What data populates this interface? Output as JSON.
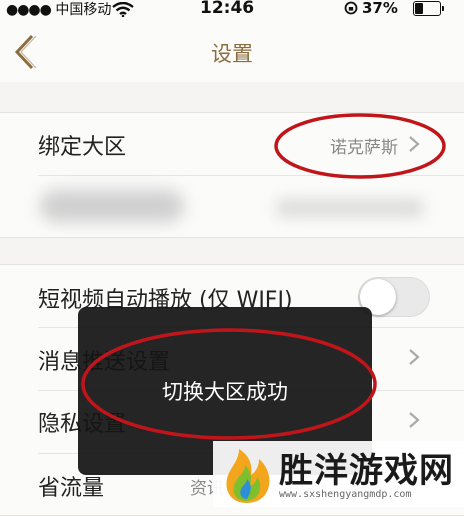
{
  "status_bar": {
    "carrier": "中国移动",
    "time": "12:46",
    "battery_percent": "37%",
    "battery_level": 0.37
  },
  "nav": {
    "back_icon": "chevron-left-icon",
    "title": "设置"
  },
  "settings": {
    "region": {
      "label": "绑定大区",
      "value": "诺克萨斯"
    },
    "autoplay": {
      "label": "短视频自动播放 (仅 WIFI)",
      "enabled": false
    },
    "push": {
      "label": "消息推送设置"
    },
    "privacy": {
      "label": "隐私设置"
    },
    "data_saver": {
      "label": "省流量",
      "value": "资讯"
    }
  },
  "toast": {
    "message": "切换大区成功"
  },
  "watermark": {
    "brand": "胜洋游戏网",
    "url": "www.sxshengyangmdp.com"
  },
  "colors": {
    "accent": "#8b6d3f",
    "highlight_circle": "#c0151a",
    "toast_bg": "#141414"
  }
}
